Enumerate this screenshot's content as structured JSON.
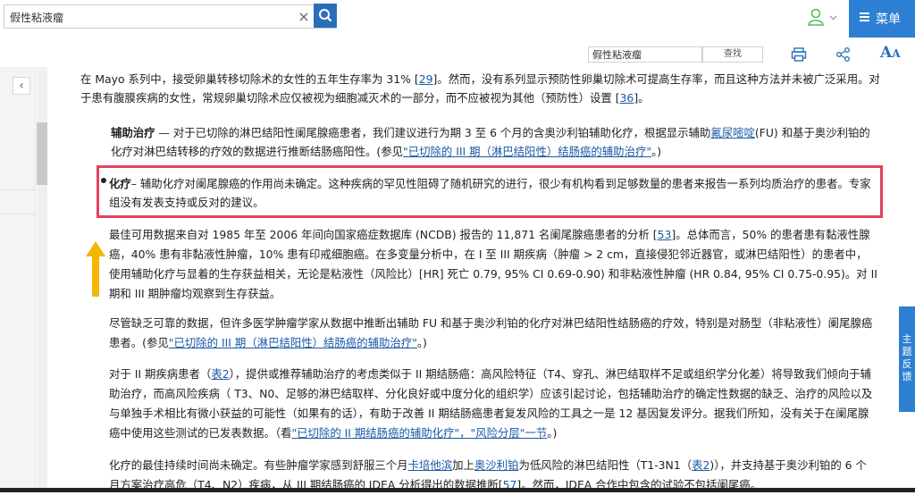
{
  "search": {
    "value": "假性粘液瘤",
    "clear_label": "×"
  },
  "header": {
    "menu_label": "菜单"
  },
  "toolbar": {
    "find_value": "假性粘液瘤",
    "find_label": "查找"
  },
  "feedback_tab": {
    "label": "主题反馈"
  },
  "colors": {
    "brand": "#2d7fd3",
    "highlight": "#e0445c",
    "arrow": "#f2b705",
    "link": "#1a5aa6",
    "user": "#5cb85c"
  },
  "content": {
    "p1": {
      "a": "在 Mayo 系列中，接受卵巢转移切除术的女性的五年生存率为 31% [",
      "ref1": "29",
      "b": "]。然而，没有系列显示预防性卵巢切除术可提高生存率，而且这种方法并未被广泛采用。对于患有腹膜疾病的女性，常规卵巢切除术应仅被视为细胞减灭术的一部分，而不应被视为其他（预防性）设置 [",
      "ref2": "36",
      "c": "]。"
    },
    "p2": {
      "title": "辅助治疗",
      "a": " — 对于已切除的淋巴结阳性阑尾腺癌患者，我们建议进行为期 3 至 6 个月的含奥沙利铂辅助化疗，根据显示辅助",
      "link1": "氟尿嘧啶",
      "b": "(FU) 和基于奥沙利铂的化疗对淋巴结转移的疗效的数据进行推断结肠癌阳性。(参见",
      "link2": "\"已切除的 III 期（淋巴结阳性）结肠癌的辅助治疗\"",
      "c": "。)"
    },
    "p3": {
      "title": "化疗",
      "text": "– 辅助化疗对阑尾腺癌的作用尚未确定。这种疾病的罕见性阻碍了随机研究的进行，很少有机构看到足够数量的患者来报告一系列均质治疗的患者。专家组没有发表支持或反对的建议。"
    },
    "p4": {
      "a": "最佳可用数据来自对 1985 年至 2006 年间向国家癌症数据库 (NCDB) 报告的 11,871 名阑尾腺癌患者的分析 [",
      "ref": "53",
      "b": "]。总体而言，50% 的患者患有黏液性腺癌，40% 患有非黏液性肿瘤，10% 患有印戒细胞癌。在多变量分析中，在 I 至 III 期疾病（肿瘤 > 2 cm，直接侵犯邻近器官，或淋巴结阳性）的患者中，使用辅助化疗与显着的生存获益相关，无论是粘液性（风险比）[HR] 死亡 0.79, 95% CI 0.69-0.90) 和非粘液性肿瘤 (HR 0.84, 95% CI 0.75-0.95)。对 II 期和 III 期肿瘤均观察到生存获益。"
    },
    "p5": {
      "a": "尽管缺乏可靠的数据，但许多医学肿瘤学家从数据中推断出辅助 FU 和基于奥沙利铂的化疗对淋巴结阳性结肠癌的疗效，特别是对肠型（非粘液性）阑尾腺癌患者。(参见",
      "link": "\"已切除的 III 期（淋巴结阳性）结肠癌的辅助治疗\"",
      "b": "。)"
    },
    "p6": {
      "a": "对于 II 期疾病患者（",
      "link1": "表2",
      "b": "），提供或推荐辅助治疗的考虑类似于 II 期结肠癌：高风险特征（T4、穿孔、淋巴结取样不足或组织学分化差）将导致我们倾向于辅助治疗，而高风险疾病（ T3、N0、足够的淋巴结取样、分化良好或中度分化的组织学）应该引起讨论，包括辅助治疗的确定性数据的缺乏、治疗的风险以及与单独手术相比有微小获益的可能性（如果有的话），有助于改善 II 期结肠癌患者复发风险的工具之一是 12 基因复发评分。据我们所知，没有关于在阑尾腺癌中使用这些测试的已发表数据。（看",
      "link2": "\"已切除的 II 期结肠癌的辅助化疗\"，\"风险分层\"一节",
      "c": "。)"
    },
    "p7": {
      "a": "化疗的最佳持续时间尚未确定。有些肿瘤学家感到舒服三个月",
      "link1": "卡培他滨",
      "b": "加上",
      "link2": "奥沙利铂",
      "c": "为低风险的淋巴结阳性（T1-3N1（",
      "link3": "表2",
      "d": ")），并支持基于奥沙利铂的 6 个月方案治疗高危（T4、N2）疾病，从 III 期结肠癌的 IDEA 分析得出的数据推断[",
      "ref": "57",
      "e": "]。然而，IDEA 合作中包含的试验不包括阑尾癌。"
    }
  }
}
